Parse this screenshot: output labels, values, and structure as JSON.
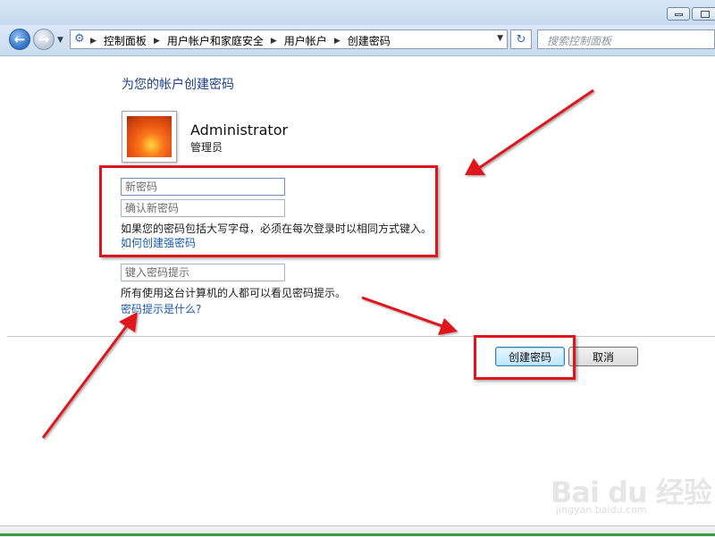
{
  "window": {
    "min_button": "minimize",
    "max_button": "maximize"
  },
  "nav": {
    "back_icon": "←",
    "forward_icon": "→",
    "history_dropdown_icon": "▼"
  },
  "address_bar": {
    "icon": "control-panel-icon",
    "breadcrumbs": [
      "控制面板",
      "用户帐户和家庭安全",
      "用户帐户",
      "创建密码"
    ],
    "separator": "▶",
    "dropdown_icon": "▼"
  },
  "refresh_icon": "↻",
  "search": {
    "placeholder": "搜索控制面板"
  },
  "content": {
    "page_title": "为您的帐户创建密码",
    "user": {
      "name": "Administrator",
      "role": "管理员"
    },
    "new_password_placeholder": "新密码",
    "confirm_password_placeholder": "确认新密码",
    "caps_note": "如果您的密码包括大写字母，必须在每次登录时以相同方式键入。",
    "strong_password_link": "如何创建强密码",
    "hint_placeholder": "键入密码提示",
    "hint_note": "所有使用这台计算机的人都可以看见密码提示。",
    "hint_link": "密码提示是什么?"
  },
  "buttons": {
    "create": "创建密码",
    "cancel": "取消"
  },
  "annotations": {
    "color": "#e0141d"
  },
  "watermark": {
    "brand": "Bai du 经验",
    "url": "jingyan.baidu.com"
  }
}
